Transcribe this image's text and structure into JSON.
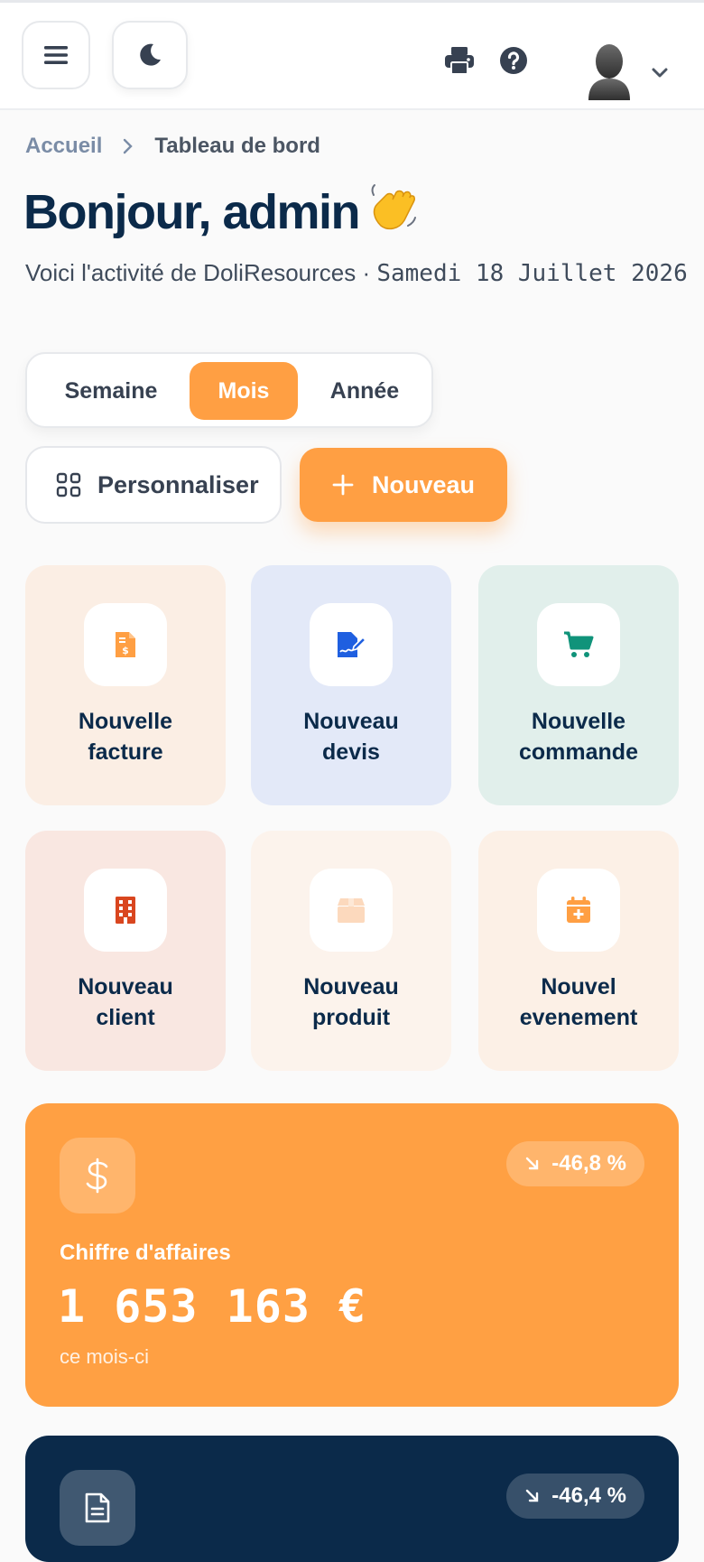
{
  "header": {
    "menu_icon": "menu-icon",
    "theme_icon": "moon-icon",
    "print_icon": "print-icon",
    "help_icon": "help-icon",
    "avatar_icon": "user-avatar-icon"
  },
  "breadcrumb": {
    "home": "Accueil",
    "current": "Tableau de bord"
  },
  "greeting": {
    "text": "Bonjour, admin",
    "emoji": "👋"
  },
  "subtitle": {
    "text": "Voici l'activité de DoliResources · ",
    "date": "Samedi 18 Juillet 2026"
  },
  "period_tabs": [
    {
      "label": "Semaine",
      "active": false
    },
    {
      "label": "Mois",
      "active": true
    },
    {
      "label": "Année",
      "active": false
    }
  ],
  "actions": {
    "customize": "Personnaliser",
    "new": "Nouveau"
  },
  "quick_actions": [
    {
      "line1": "Nouvelle",
      "line2": "facture",
      "icon": "invoice-icon",
      "bg": "#fbeee4",
      "color": "#ff9f43"
    },
    {
      "line1": "Nouveau",
      "line2": "devis",
      "icon": "quote-icon",
      "bg": "#e3e9f8",
      "color": "#1f5fe0"
    },
    {
      "line1": "Nouvelle",
      "line2": "commande",
      "icon": "cart-icon",
      "bg": "#e1efeb",
      "color": "#10937a"
    },
    {
      "line1": "Nouveau",
      "line2": "client",
      "icon": "building-icon",
      "bg": "#f9e7e1",
      "color": "#d9461f"
    },
    {
      "line1": "Nouveau",
      "line2": "produit",
      "icon": "box-icon",
      "bg": "#fcf3ec",
      "color": "#fcd9bd"
    },
    {
      "line1": "Nouvel",
      "line2": "evenement",
      "icon": "calendar-icon",
      "bg": "#fcf0e6",
      "color": "#ff9f43"
    }
  ],
  "kpis": [
    {
      "label": "Chiffre d'affaires",
      "value": "1 653 163 €",
      "period": "ce mois-ci",
      "trend": "-46,8 %",
      "icon": "dollar-icon",
      "color": "#ffa043"
    },
    {
      "label": "",
      "value": "",
      "period": "",
      "trend": "-46,4 %",
      "icon": "document-icon",
      "color": "#0b2a4a"
    }
  ]
}
